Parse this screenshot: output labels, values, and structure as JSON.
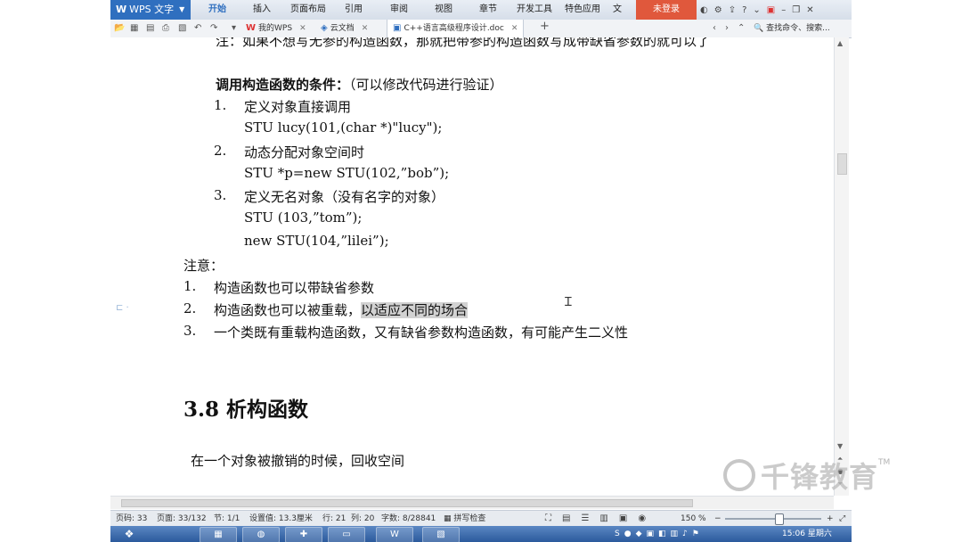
{
  "app": {
    "name": "WPS 文字",
    "ribbon_tabs": [
      "开始",
      "插入",
      "页面布局",
      "引用",
      "审阅",
      "视图",
      "章节",
      "开发工具",
      "特色应用",
      "文"
    ],
    "login_label": "未登录"
  },
  "doc_tabs": [
    {
      "label": "我的WPS"
    },
    {
      "label": "云文档"
    },
    {
      "label": "C++语言高级程序设计.doc"
    }
  ],
  "search": {
    "label": "查找命令、搜索..."
  },
  "document": {
    "top_partial": "注：如果不想写无参的构造函数，那就把带参的构造函数写成带缺省参数的就可以了",
    "conditions_title": "调用构造函数的条件：",
    "conditions_note": "（可以修改代码进行验证）",
    "conditions": [
      {
        "num": "1.",
        "text": "定义对象直接调用",
        "code": [
          "STU lucy(101,(char *)\"lucy\");"
        ]
      },
      {
        "num": "2.",
        "text": "动态分配对象空间时",
        "code": [
          "STU *p=new STU(102,”bob”);"
        ]
      },
      {
        "num": "3.",
        "text": "定义无名对象（没有名字的对象）",
        "code": [
          "STU (103,”tom”);",
          "new    STU(104,”lilei”);"
        ]
      }
    ],
    "notes_title": "注意：",
    "notes": [
      {
        "num": "1.",
        "text": "构造函数也可以带缺省参数"
      },
      {
        "num": "2.",
        "text": "构造函数也可以被重载，",
        "highlight": "以适应不同的场合"
      },
      {
        "num": "3.",
        "text": "一个类既有重载构造函数，又有缺省参数构造函数，有可能产生二义性"
      }
    ],
    "heading": "3.8 析构函数",
    "paragraph": "在一个对象被撤销的时候，回收空间"
  },
  "status_bar": {
    "page": "页码: 33",
    "pages": "页面: 33/132",
    "section": "节: 1/1",
    "setting": "设置值: 13.3厘米",
    "row": "行: 21",
    "col": "列: 20",
    "words": "字数: 8/28841",
    "spell": "拼写检查",
    "zoom": "150 %"
  },
  "taskbar": {
    "time": "15:06",
    "day": "星期六"
  },
  "watermark": {
    "text": "千锋教育",
    "tm": "TM"
  }
}
